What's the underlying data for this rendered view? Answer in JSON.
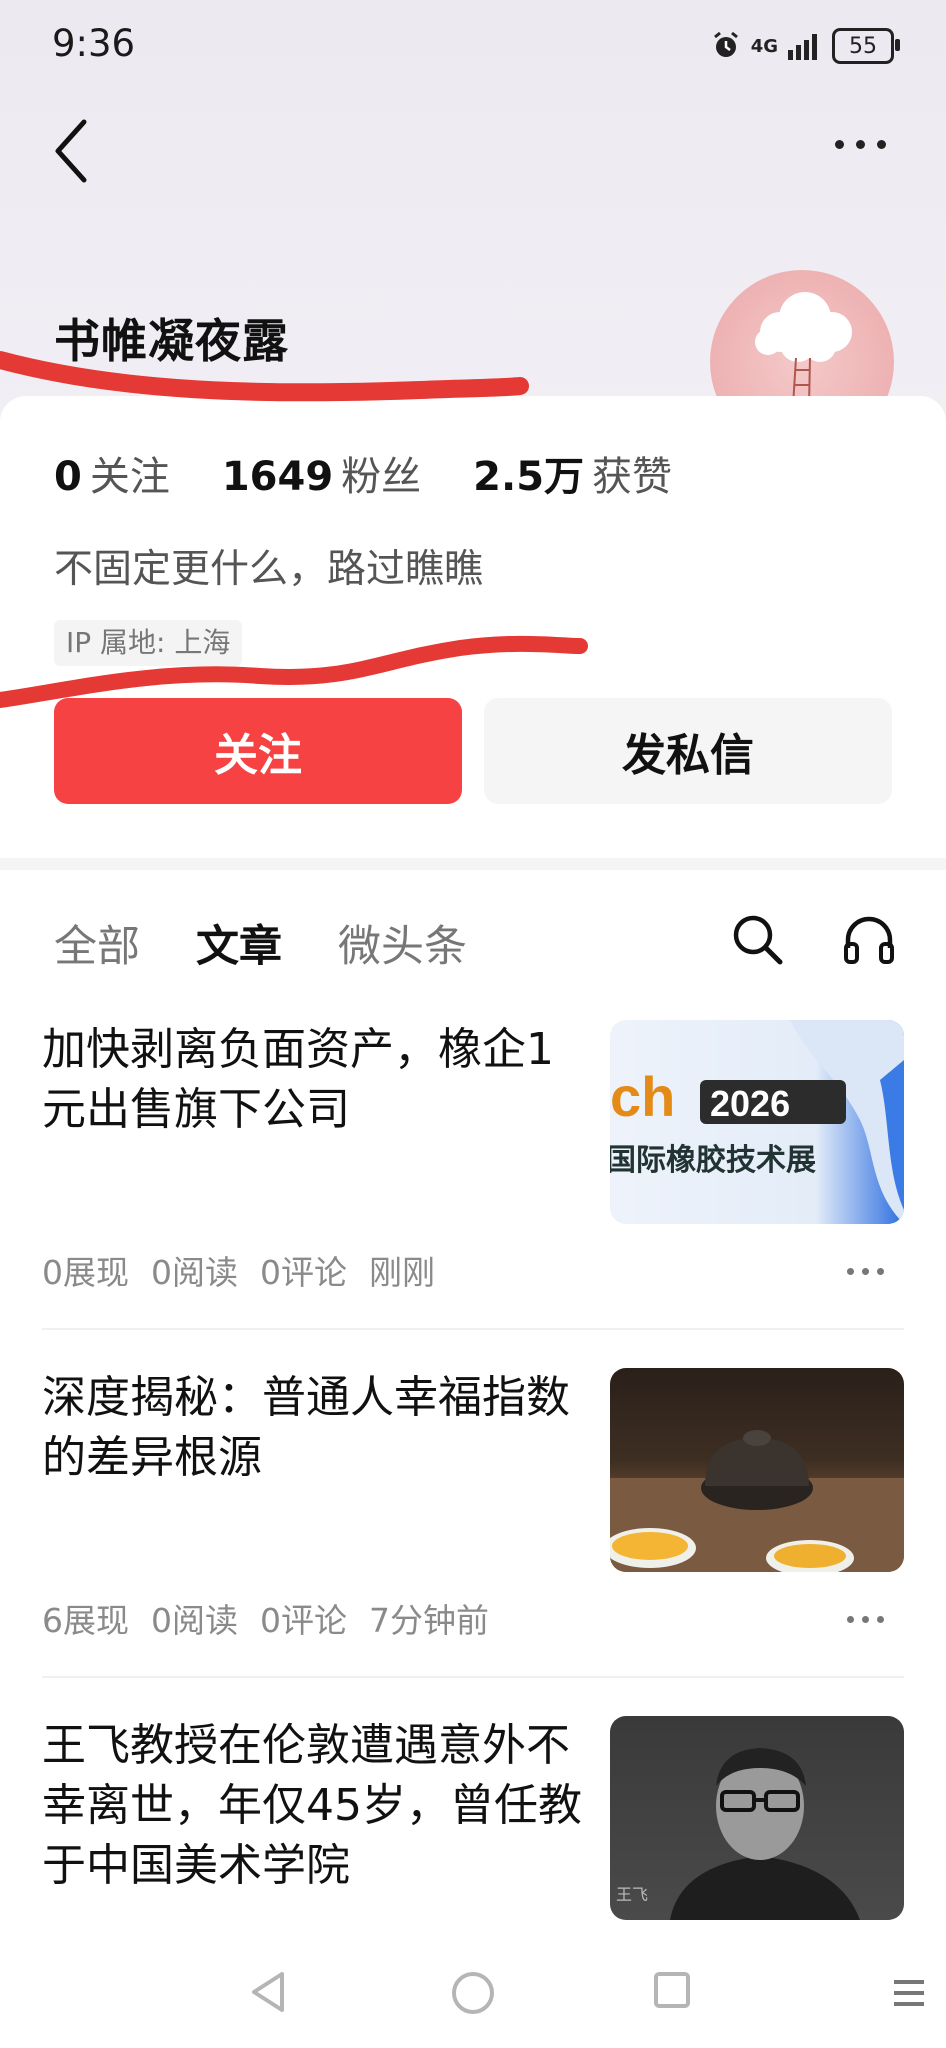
{
  "status_bar": {
    "time": "9:36",
    "network": "4G",
    "battery": "55"
  },
  "profile": {
    "name": "书帷凝夜露",
    "stats": [
      {
        "value": "0",
        "label": "关注"
      },
      {
        "value": "1649",
        "label": "粉丝"
      },
      {
        "value": "2.5万",
        "label": "获赞"
      }
    ],
    "bio": "不固定更什么，路过瞧瞧",
    "ip": "IP 属地: 上海"
  },
  "buttons": {
    "follow": "关注",
    "message": "发私信"
  },
  "tabs": [
    {
      "label": "全部",
      "active": false
    },
    {
      "label": "文章",
      "active": true
    },
    {
      "label": "微头条",
      "active": false
    }
  ],
  "articles": [
    {
      "title": "加快剥离负面资产，橡企1元出售旗下公司",
      "thumb_text_1": "ch",
      "thumb_text_2": "2026",
      "thumb_text_3": "国际橡胶技术展",
      "impressions": "0展现",
      "reads": "0阅读",
      "comments": "0评论",
      "time": "刚刚"
    },
    {
      "title": "深度揭秘：普通人幸福指数的差异根源",
      "impressions": "6展现",
      "reads": "0阅读",
      "comments": "0评论",
      "time": "7分钟前"
    },
    {
      "title": "王飞教授在伦敦遭遇意外不幸离世，年仅45岁，曾任教于中国美术学院",
      "thumb_caption": "王飞"
    }
  ],
  "colors": {
    "accent": "#f64242",
    "scribble": "#e53935"
  }
}
